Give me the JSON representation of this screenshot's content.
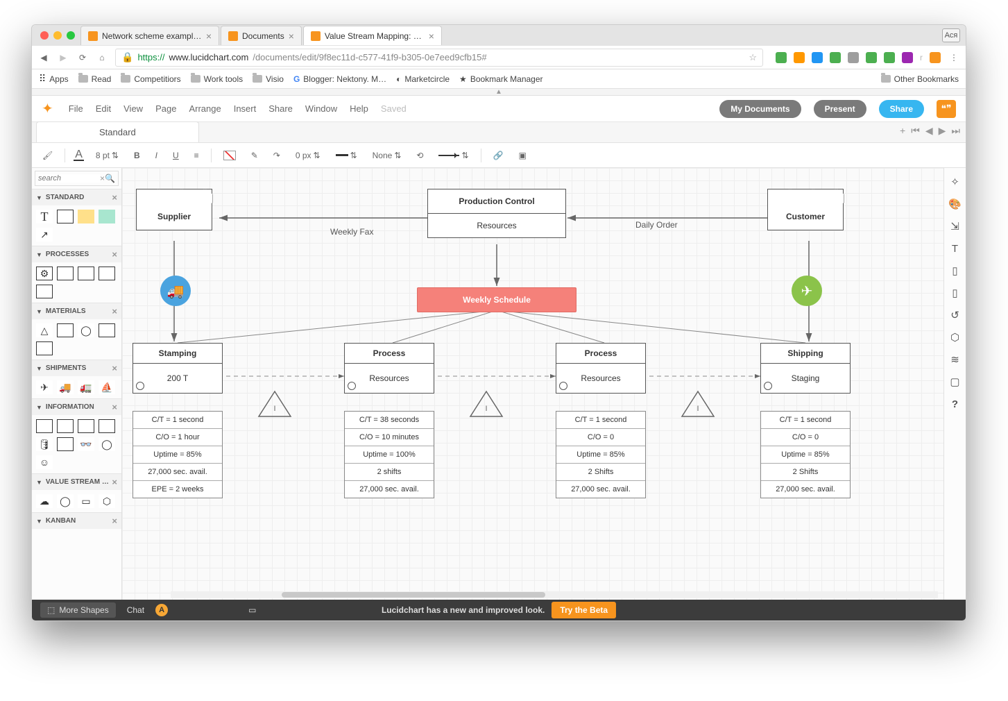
{
  "browser": {
    "tabs": [
      {
        "title": "Network scheme example: Lu"
      },
      {
        "title": "Documents"
      },
      {
        "title": "Value Stream Mapping: Lucid"
      }
    ],
    "avatar": "Ася",
    "url": {
      "secure_prefix": "https://",
      "host": "www.lucidchart.com",
      "path": "/documents/edit/9f8ec11d-c577-41f9-b305-0e7eed9cfb15#"
    },
    "bookmarks": [
      "Apps",
      "Read",
      "Competitiors",
      "Work tools",
      "Visio",
      "Blogger: Nektony. M…",
      "Marketcircle",
      "Bookmark Manager"
    ],
    "other_bookmarks": "Other Bookmarks"
  },
  "menu": {
    "items": [
      "File",
      "Edit",
      "View",
      "Page",
      "Arrange",
      "Insert",
      "Share",
      "Window",
      "Help"
    ],
    "saved": "Saved",
    "my_docs": "My Documents",
    "present": "Present",
    "share": "Share"
  },
  "doc_tab": "Standard",
  "toolbar": {
    "font_size": "8 pt",
    "border_px": "0 px",
    "line_style": "None"
  },
  "left": {
    "search_placeholder": "search",
    "sections": {
      "standard": "STANDARD",
      "processes": "PROCESSES",
      "materials": "MATERIALS",
      "shipments": "SHIPMENTS",
      "information": "INFORMATION",
      "vsm": "VALUE STREAM …",
      "kanban": "KANBAN"
    }
  },
  "canvas": {
    "supplier": "Supplier",
    "customer": "Customer",
    "control_title": "Production Control",
    "control_body": "Resources",
    "weekly_fax": "Weekly Fax",
    "daily_order": "Daily Order",
    "schedule": "Weekly Schedule",
    "processes": [
      {
        "title": "Stamping",
        "body": "200 T"
      },
      {
        "title": "Process",
        "body": "Resources"
      },
      {
        "title": "Process",
        "body": "Resources"
      },
      {
        "title": "Shipping",
        "body": "Staging"
      }
    ],
    "data": [
      [
        "C/T = 1 second",
        "C/O = 1 hour",
        "Uptime = 85%",
        "27,000 sec. avail.",
        "EPE = 2 weeks"
      ],
      [
        "C/T = 38 seconds",
        "C/O = 10 minutes",
        "Uptime = 100%",
        "2 shifts",
        "27,000 sec. avail."
      ],
      [
        "C/T = 1 second",
        "C/O = 0",
        "Uptime = 85%",
        "2 Shifts",
        "27,000 sec. avail."
      ],
      [
        "C/T = 1 second",
        "C/O = 0",
        "Uptime = 85%",
        "2 Shifts",
        "27,000 sec. avail."
      ]
    ]
  },
  "footer": {
    "more_shapes": "More Shapes",
    "chat": "Chat",
    "banner": "Lucidchart has a new and improved look.",
    "beta": "Try the Beta"
  }
}
